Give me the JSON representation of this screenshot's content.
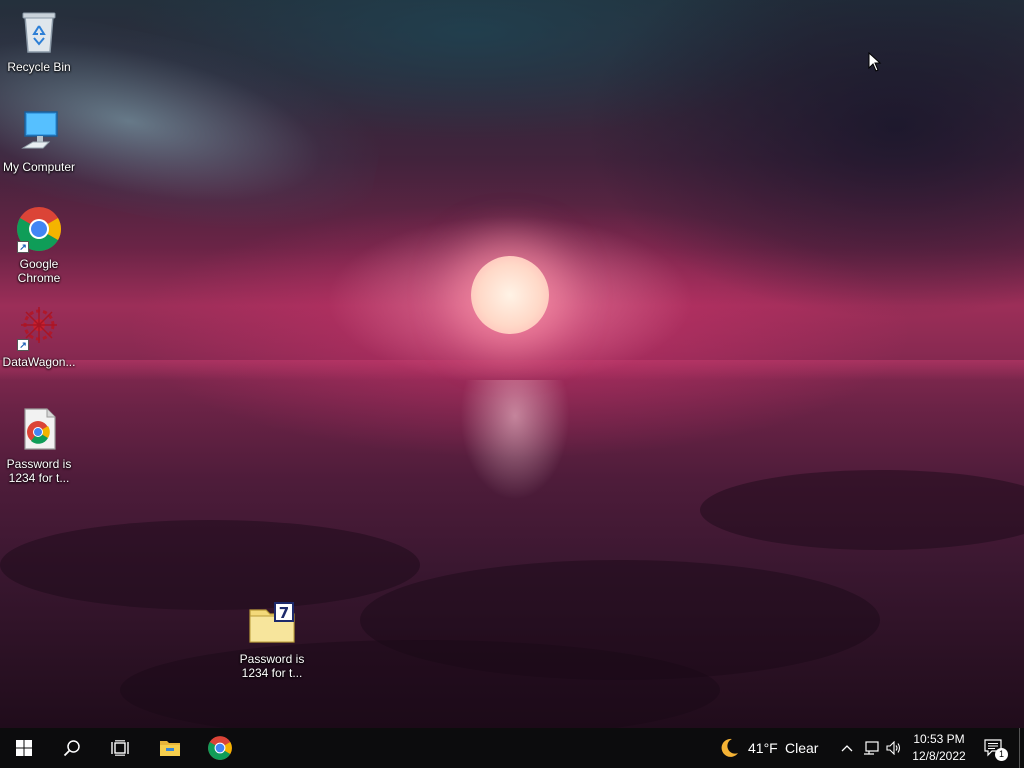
{
  "desktop": {
    "icons": [
      {
        "name": "recycle-bin",
        "label": "Recycle Bin"
      },
      {
        "name": "my-computer",
        "label": "My Computer"
      },
      {
        "name": "google-chrome",
        "label": "Google Chrome"
      },
      {
        "name": "datawagon",
        "label": "DataWagon..."
      },
      {
        "name": "password-chrome-file",
        "label": "Password is 1234 for t..."
      },
      {
        "name": "password-7zip-file",
        "label": "Password is 1234 for t..."
      }
    ]
  },
  "taskbar": {
    "pinned": [
      "start-icon",
      "search-icon",
      "task-view-icon",
      "file-explorer-icon",
      "chrome-icon"
    ],
    "weather": {
      "icon": "moon-icon",
      "temperature": "41°F",
      "condition": "Clear"
    },
    "tray": [
      "chevron-up-icon",
      "network-icon",
      "volume-icon"
    ],
    "clock": {
      "time": "10:53 PM",
      "date": "12/8/2022"
    },
    "notifications": {
      "count": "1"
    }
  }
}
